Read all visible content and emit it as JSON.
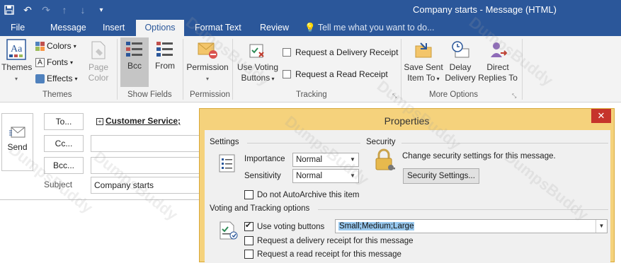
{
  "window": {
    "title": "Company starts - Message (HTML)"
  },
  "tabs": [
    {
      "label": "File",
      "active": false
    },
    {
      "label": "Message",
      "active": false
    },
    {
      "label": "Insert",
      "active": false
    },
    {
      "label": "Options",
      "active": true
    },
    {
      "label": "Format Text",
      "active": false
    },
    {
      "label": "Review",
      "active": false
    }
  ],
  "tell_me": "Tell me what you want to do...",
  "ribbon": {
    "themes": {
      "themes": "Themes",
      "colors": "Colors",
      "fonts": "Fonts",
      "effects": "Effects",
      "page_color_line1": "Page",
      "page_color_line2": "Color",
      "group": "Themes"
    },
    "show_fields": {
      "bcc": "Bcc",
      "from": "From",
      "group": "Show Fields"
    },
    "permission": {
      "permission": "Permission",
      "group": "Permission"
    },
    "tracking": {
      "use_voting_line1": "Use Voting",
      "use_voting_line2": "Buttons",
      "delivery_receipt": "Request a Delivery Receipt",
      "read_receipt": "Request a Read Receipt",
      "group": "Tracking"
    },
    "more_options": {
      "save_sent_line1": "Save Sent",
      "save_sent_line2": "Item To",
      "delay_line1": "Delay",
      "delay_line2": "Delivery",
      "direct_line1": "Direct",
      "direct_line2": "Replies To",
      "group": "More Options"
    }
  },
  "compose": {
    "send": "Send",
    "to_button": "To...",
    "cc_button": "Cc...",
    "bcc_button": "Bcc...",
    "to_value": "Customer Service;",
    "subject_label": "Subject",
    "subject_value": "Company starts"
  },
  "dialog": {
    "title": "Properties",
    "settings_label": "Settings",
    "importance_label": "Importance",
    "importance_value": "Normal",
    "sensitivity_label": "Sensitivity",
    "sensitivity_value": "Normal",
    "autoarchive": "Do not AutoArchive this item",
    "security_label": "Security",
    "security_text": "Change security settings for this message.",
    "security_button": "Security Settings...",
    "voting_label": "Voting and Tracking options",
    "use_voting": "Use voting buttons",
    "use_voting_checked": true,
    "voting_value": "Small;Medium;Large",
    "delivery_receipt": "Request a delivery receipt for this message",
    "read_receipt": "Request a read receipt for this message"
  },
  "watermark": "DumpsBuddy",
  "colors": {
    "accent": "#2b579a",
    "dialog_frame": "#f5d27c",
    "close": "#c6342b",
    "selection": "#99c9ef"
  }
}
